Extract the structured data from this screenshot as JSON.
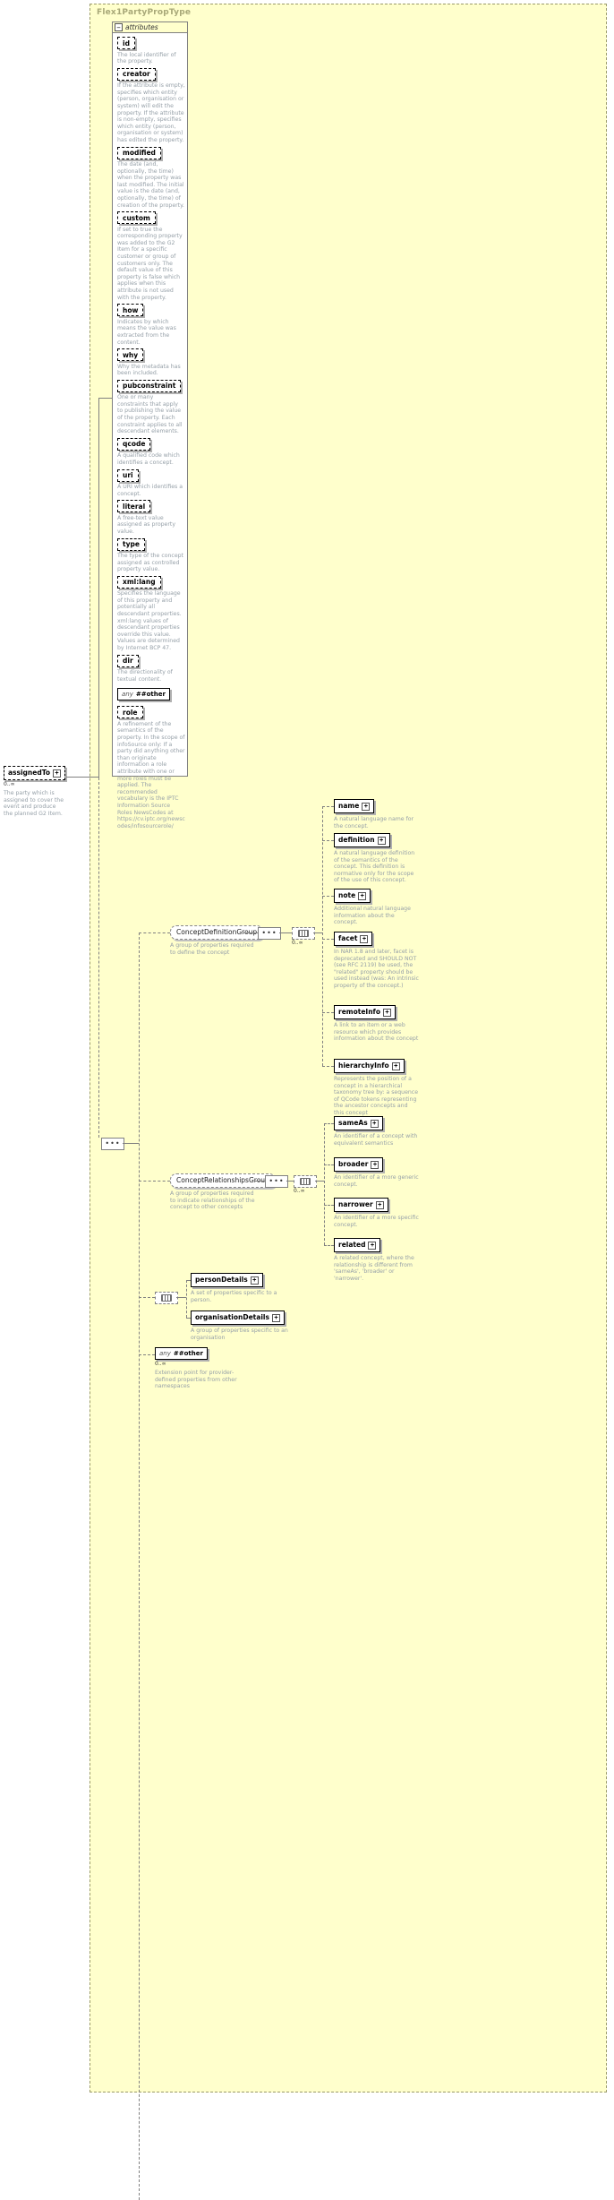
{
  "diagram": {
    "type_title": "Flex1PartyPropType",
    "attributes_label": "attributes",
    "collapse_icon": "minus-icon"
  },
  "attributes": [
    {
      "name": "id",
      "desc": "The local identifier of the property."
    },
    {
      "name": "creator",
      "desc": "If the attribute is empty, specifies which entity (person, organisation or system) will edit the property. If the attribute is non-empty, specifies which entity (person, organisation or system) has edited the property."
    },
    {
      "name": "modified",
      "desc": "The date (and, optionally, the time) when the property was last modified. The initial value is the date (and, optionally, the time) of creation of the property."
    },
    {
      "name": "custom",
      "desc": "If set to true the corresponding property was added to the G2 Item for a specific customer or group of customers only. The default value of this property is false which applies when this attribute is not used with the property."
    },
    {
      "name": "how",
      "desc": "Indicates by which means the value was extracted from the content."
    },
    {
      "name": "why",
      "desc": "Why the metadata has been included."
    },
    {
      "name": "pubconstraint",
      "desc": "One or many constraints that apply to publishing the value of the property. Each constraint applies to all descendant elements."
    },
    {
      "name": "qcode",
      "desc": "A qualified code which identifies a concept."
    },
    {
      "name": "uri",
      "desc": "A URI which identifies a concept."
    },
    {
      "name": "literal",
      "desc": "A free-text value assigned as property value."
    },
    {
      "name": "type",
      "desc": "The type of the concept assigned as controlled property value."
    },
    {
      "name": "xml:lang",
      "desc": "Specifies the language of this property and potentially all descendant properties. xml:lang values of descendant properties override this value. Values are determined by Internet BCP 47."
    },
    {
      "name": "dir",
      "desc": "The directionality of textual content."
    }
  ],
  "attr_any": {
    "label": "any",
    "ns": "##other"
  },
  "attr_role": {
    "name": "role",
    "desc": "A refinement of the semantics of the property. In the scope of infoSource only: If a party did anything other than originate information a role attribute with one or more roles must be applied. The recommended vocabulary is the IPTC Information Source Roles NewsCodes at https://cv.iptc.org/newscodes/infosourcerole/"
  },
  "root_element": {
    "name": "assignedTo",
    "cardinality": "0..∞",
    "desc": "The party which is assigned to cover the event and produce the planned G2 Item.",
    "expand_icon": "plus-icon"
  },
  "groups": [
    {
      "name": "ConceptDefinitionGroup",
      "desc": "A group of properties required to define the concept",
      "cardinality": "0..∞",
      "children": [
        {
          "name": "name",
          "desc": "A natural language name for the concept.",
          "expand_icon": "plus-icon"
        },
        {
          "name": "definition",
          "desc": "A natural language definition of the semantics of the concept. This definition is normative only for the scope of the use of this concept.",
          "expand_icon": "plus-icon"
        },
        {
          "name": "note",
          "desc": "Additional natural language information about the concept.",
          "expand_icon": "plus-icon"
        },
        {
          "name": "facet",
          "desc": "In NAR 1.8 and later, facet is deprecated and SHOULD NOT (see RFC 2119) be used, the \"related\" property should be used instead (was: An intrinsic property of the concept.)",
          "expand_icon": "plus-icon"
        },
        {
          "name": "remoteInfo",
          "desc": "A link to an item or a web resource which provides information about the concept",
          "expand_icon": "plus-icon"
        },
        {
          "name": "hierarchyInfo",
          "desc": "Represents the position of a concept in a hierarchical taxonomy tree by: a sequence of QCode tokens representing the ancestor concepts and this concept",
          "expand_icon": "plus-icon"
        }
      ]
    },
    {
      "name": "ConceptRelationshipsGroup",
      "desc": "A group of properties required to indicate relationships of the concept to other concepts",
      "cardinality": "0..∞",
      "children": [
        {
          "name": "sameAs",
          "desc": "An identifier of a concept with equivalent semantics",
          "expand_icon": "plus-icon"
        },
        {
          "name": "broader",
          "desc": "An identifier of a more generic concept.",
          "expand_icon": "plus-icon"
        },
        {
          "name": "narrower",
          "desc": "An identifier of a more specific concept.",
          "expand_icon": "plus-icon"
        },
        {
          "name": "related",
          "desc": "A related concept, where the relationship is different from 'sameAs', 'broader' or 'narrower'.",
          "expand_icon": "plus-icon"
        }
      ]
    }
  ],
  "detail_choice": [
    {
      "name": "personDetails",
      "desc": "A set of properties specific to a person.",
      "expand_icon": "plus-icon"
    },
    {
      "name": "organisationDetails",
      "desc": "A group of properties specific to an organisation",
      "expand_icon": "plus-icon"
    }
  ],
  "trailing_any": {
    "label": "any",
    "ns": "##other",
    "cardinality": "0..∞",
    "desc": "Extension point for provider-defined properties from other namespaces"
  },
  "symbols": {
    "sequence": "sequence-icon",
    "choice": "choice-icon",
    "plus": "+",
    "minus": "−"
  }
}
